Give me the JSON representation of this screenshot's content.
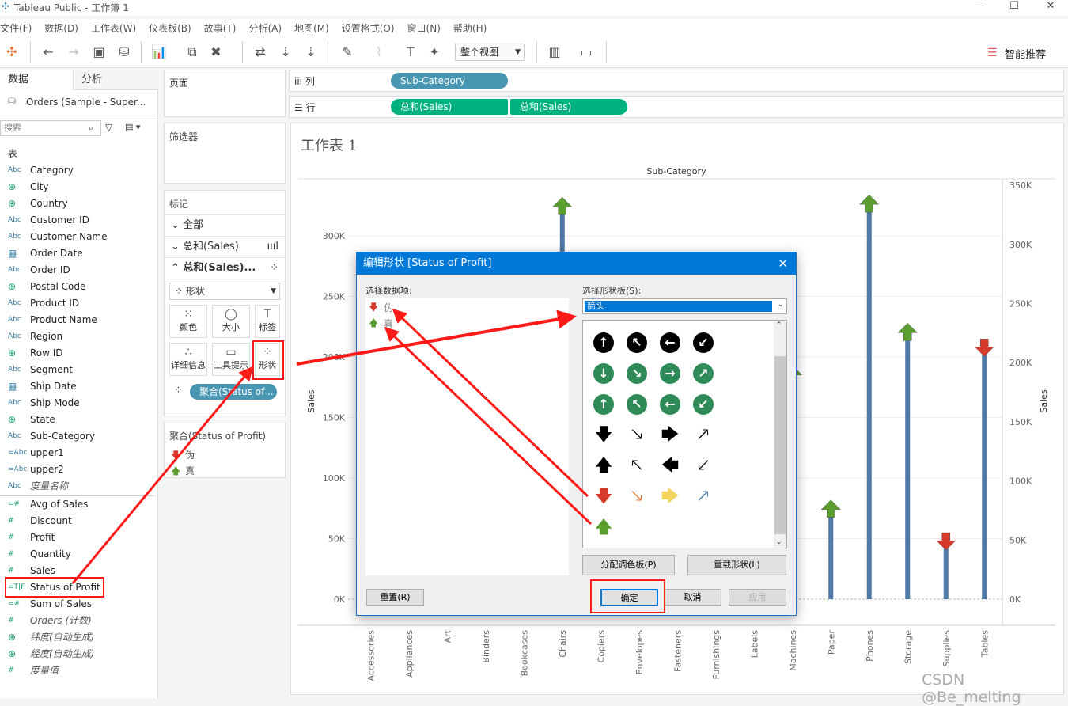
{
  "window": {
    "title": "Tableau Public - 工作簿 1"
  },
  "menu": [
    "文件(F)",
    "数据(D)",
    "工作表(W)",
    "仪表板(B)",
    "故事(T)",
    "分析(A)",
    "地图(M)",
    "设置格式(O)",
    "窗口(N)",
    "帮助(H)"
  ],
  "toolbar": {
    "fit": "整个视图",
    "smart": "智能推荐"
  },
  "datapanel": {
    "tab_data": "数据",
    "tab_analysis": "分析",
    "source": "Orders (Sample - Super...",
    "search_placeholder": "搜索",
    "table_header": "表",
    "dimensions": [
      {
        "t": "Abc",
        "n": "Category"
      },
      {
        "t": "geo",
        "n": "City"
      },
      {
        "t": "geo",
        "n": "Country"
      },
      {
        "t": "Abc",
        "n": "Customer ID"
      },
      {
        "t": "Abc",
        "n": "Customer Name"
      },
      {
        "t": "date",
        "n": "Order Date"
      },
      {
        "t": "Abc",
        "n": "Order ID"
      },
      {
        "t": "geo",
        "n": "Postal Code"
      },
      {
        "t": "Abc",
        "n": "Product ID"
      },
      {
        "t": "Abc",
        "n": "Product Name"
      },
      {
        "t": "Abc",
        "n": "Region"
      },
      {
        "t": "geo",
        "n": "Row ID"
      },
      {
        "t": "Abc",
        "n": "Segment"
      },
      {
        "t": "date",
        "n": "Ship Date"
      },
      {
        "t": "Abc",
        "n": "Ship Mode"
      },
      {
        "t": "geo",
        "n": "State"
      },
      {
        "t": "Abc",
        "n": "Sub-Category"
      },
      {
        "t": "=Abc",
        "n": "upper1"
      },
      {
        "t": "=Abc",
        "n": "upper2"
      },
      {
        "t": "Abc",
        "n": "度量名称",
        "i": true
      }
    ],
    "measures": [
      {
        "t": "=#",
        "n": "Avg of Sales"
      },
      {
        "t": "#",
        "n": "Discount"
      },
      {
        "t": "#",
        "n": "Profit"
      },
      {
        "t": "#",
        "n": "Quantity"
      },
      {
        "t": "#",
        "n": "Sales"
      },
      {
        "t": "=T|F",
        "n": "Status of Profit"
      },
      {
        "t": "=#",
        "n": "Sum of Sales"
      },
      {
        "t": "#",
        "n": "Orders (计数)",
        "i": true
      },
      {
        "t": "geo",
        "n": "纬度(自动生成)",
        "i": true
      },
      {
        "t": "geo",
        "n": "经度(自动生成)",
        "i": true
      },
      {
        "t": "#",
        "n": "度量值",
        "i": true
      }
    ]
  },
  "shelves": {
    "pages": "页面",
    "filters": "筛选器",
    "marks": "标记",
    "all": "全部",
    "sum_sales": "总和(Sales)",
    "sum_sales2": "总和(Sales)...",
    "mark_type": "形状",
    "buttons": [
      "颜色",
      "大小",
      "标签",
      "详细信息",
      "工具提示",
      "形状"
    ],
    "shape_pill": "聚合(Status of ..",
    "legend_title": "聚合(Status of Profit)",
    "legend": [
      "伪",
      "真"
    ]
  },
  "columns": {
    "label": "列",
    "pills": [
      "Sub-Category"
    ]
  },
  "rows": {
    "label": "行",
    "pills": [
      "总和(Sales)",
      "总和(Sales)"
    ]
  },
  "sheet": {
    "title": "工作表 1"
  },
  "colors": {
    "bar": "#4e79a7",
    "true": "#5a9e2f",
    "false": "#d63a2b",
    "pill_dim": "#4996b2",
    "pill_mea": "#00b180",
    "accent": "#0078d7",
    "annotation": "#ff1a1a"
  },
  "chart_data": {
    "type": "bar",
    "title": "Sub-Category",
    "ylabel": "Sales",
    "y2label": "Sales",
    "ylim": [
      0,
      340000
    ],
    "y2lim": [
      0,
      350000
    ],
    "yticks": [
      "0K",
      "50K",
      "100K",
      "150K",
      "200K",
      "250K",
      "300K"
    ],
    "y2ticks": [
      "0K",
      "50K",
      "100K",
      "150K",
      "200K",
      "250K",
      "300K",
      "350K"
    ],
    "categories": [
      "Accessories",
      "Appliances",
      "Art",
      "Binders",
      "Bookcases",
      "Chairs",
      "Copiers",
      "Envelopes",
      "Fasteners",
      "Furnishings",
      "Labels",
      "Machines",
      "Paper",
      "Phones",
      "Storage",
      "Supplies",
      "Tables"
    ],
    "values": [
      null,
      null,
      null,
      null,
      null,
      328000,
      null,
      null,
      null,
      null,
      null,
      189000,
      78000,
      330000,
      224000,
      47000,
      207000
    ],
    "status": [
      null,
      null,
      null,
      null,
      null,
      true,
      null,
      null,
      null,
      null,
      null,
      true,
      true,
      true,
      true,
      false,
      false
    ]
  },
  "dialog": {
    "title": "编辑形状 [Status of Profit]",
    "select_item": "选择数据项:",
    "items": [
      "伪",
      "真"
    ],
    "select_palette": "选择形状板(S):",
    "palette": "箭头",
    "assign": "分配调色板(P)",
    "reload": "重载形状(L)",
    "reset": "重置(R)",
    "ok": "确定",
    "cancel": "取消",
    "apply": "应用"
  },
  "watermark": "CSDN @Be_melting"
}
